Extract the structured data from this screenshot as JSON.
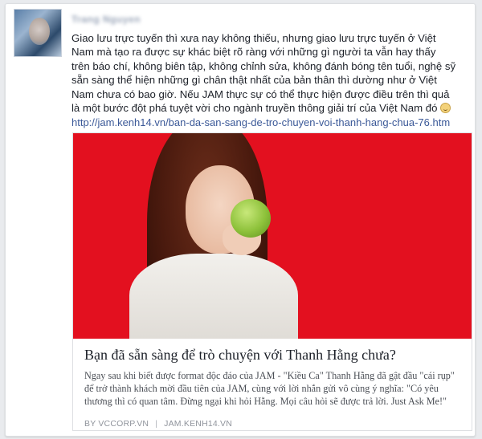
{
  "post": {
    "author_name": "Trang Nguyen",
    "text": "Giao lưu trực tuyến thì xưa nay không thiếu, nhưng giao lưu trực tuyến ở Việt\nNam mà tạo ra được sự khác biệt rõ ràng với những gì người ta vẫn hay thấy\ntrên báo chí, không biên tập, không chỉnh sửa, không đánh bóng tên tuổi, nghệ sỹ\nsẵn sàng thể hiện những gì chân thật nhất của bản thân thì dường như ở Việt\nNam chưa có bao giờ. Nếu JAM thực sự có thể thực hiện được điều trên thì quả\nlà một bước đột phá tuyệt vời cho ngành truyền thông giải trí của Việt Nam đó",
    "emoji": "smile-icon",
    "link": "http://jam.kenh14.vn/ban-da-san-sang-de-tro-chuyen-voi-thanh-hang-chua-76.htm"
  },
  "share": {
    "title": "Bạn đã sẵn sàng để trò chuyện với Thanh Hằng chưa?",
    "description": "Ngay sau khi biết được format độc đáo của JAM - \"Kiều Ca\" Thanh Hằng đã gật đầu \"cái rụp\" để trở thành khách mời đầu tiên của JAM, cùng với lời nhắn gửi vô cùng ý nghĩa: \"Có yêu thương thì có quan tâm. Đừng ngại khi hỏi Hằng. Mọi câu hỏi sẽ được trả lời. Just Ask Me!\"",
    "source_by": "BY VCCORP.VN",
    "source_separator": "|",
    "source_domain": "JAM.KENH14.VN"
  },
  "colors": {
    "link": "#3b5998",
    "image_background": "#e3101f",
    "text": "#1d2129",
    "muted": "#90949c"
  }
}
